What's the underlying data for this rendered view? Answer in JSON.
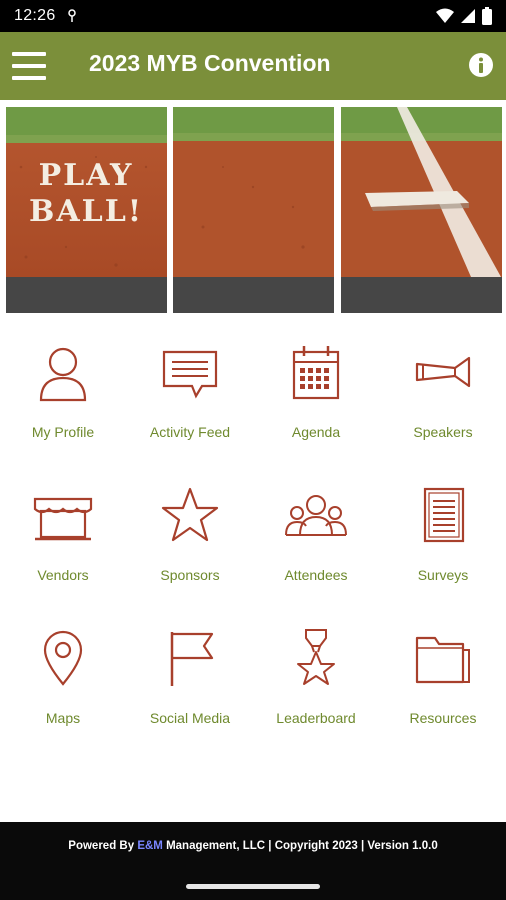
{
  "status_bar": {
    "time": "12:26"
  },
  "app_bar": {
    "title": "2023 MYB Convention"
  },
  "banner": {
    "text_line1": "PLAY",
    "text_line2": "BALL!"
  },
  "grid": {
    "items": [
      {
        "label": "My Profile",
        "icon": "person-icon"
      },
      {
        "label": "Activity Feed",
        "icon": "chat-bubble-icon"
      },
      {
        "label": "Agenda",
        "icon": "calendar-icon"
      },
      {
        "label": "Speakers",
        "icon": "megaphone-icon"
      },
      {
        "label": "Vendors",
        "icon": "storefront-icon"
      },
      {
        "label": "Sponsors",
        "icon": "star-icon"
      },
      {
        "label": "Attendees",
        "icon": "group-icon"
      },
      {
        "label": "Surveys",
        "icon": "document-icon"
      },
      {
        "label": "Maps",
        "icon": "map-pin-icon"
      },
      {
        "label": "Social Media",
        "icon": "flag-icon"
      },
      {
        "label": "Leaderboard",
        "icon": "medal-icon"
      },
      {
        "label": "Resources",
        "icon": "folder-icon"
      }
    ]
  },
  "footer": {
    "prefix": "Powered By ",
    "brand": "E&M",
    "suffix": " Management, LLC | Copyright 2023 | Version 1.0.0"
  },
  "colors": {
    "app_bar": "#7b8f3a",
    "label": "#6f8a2e",
    "icon": "#a8402c",
    "footer": "#0a0a0a"
  }
}
